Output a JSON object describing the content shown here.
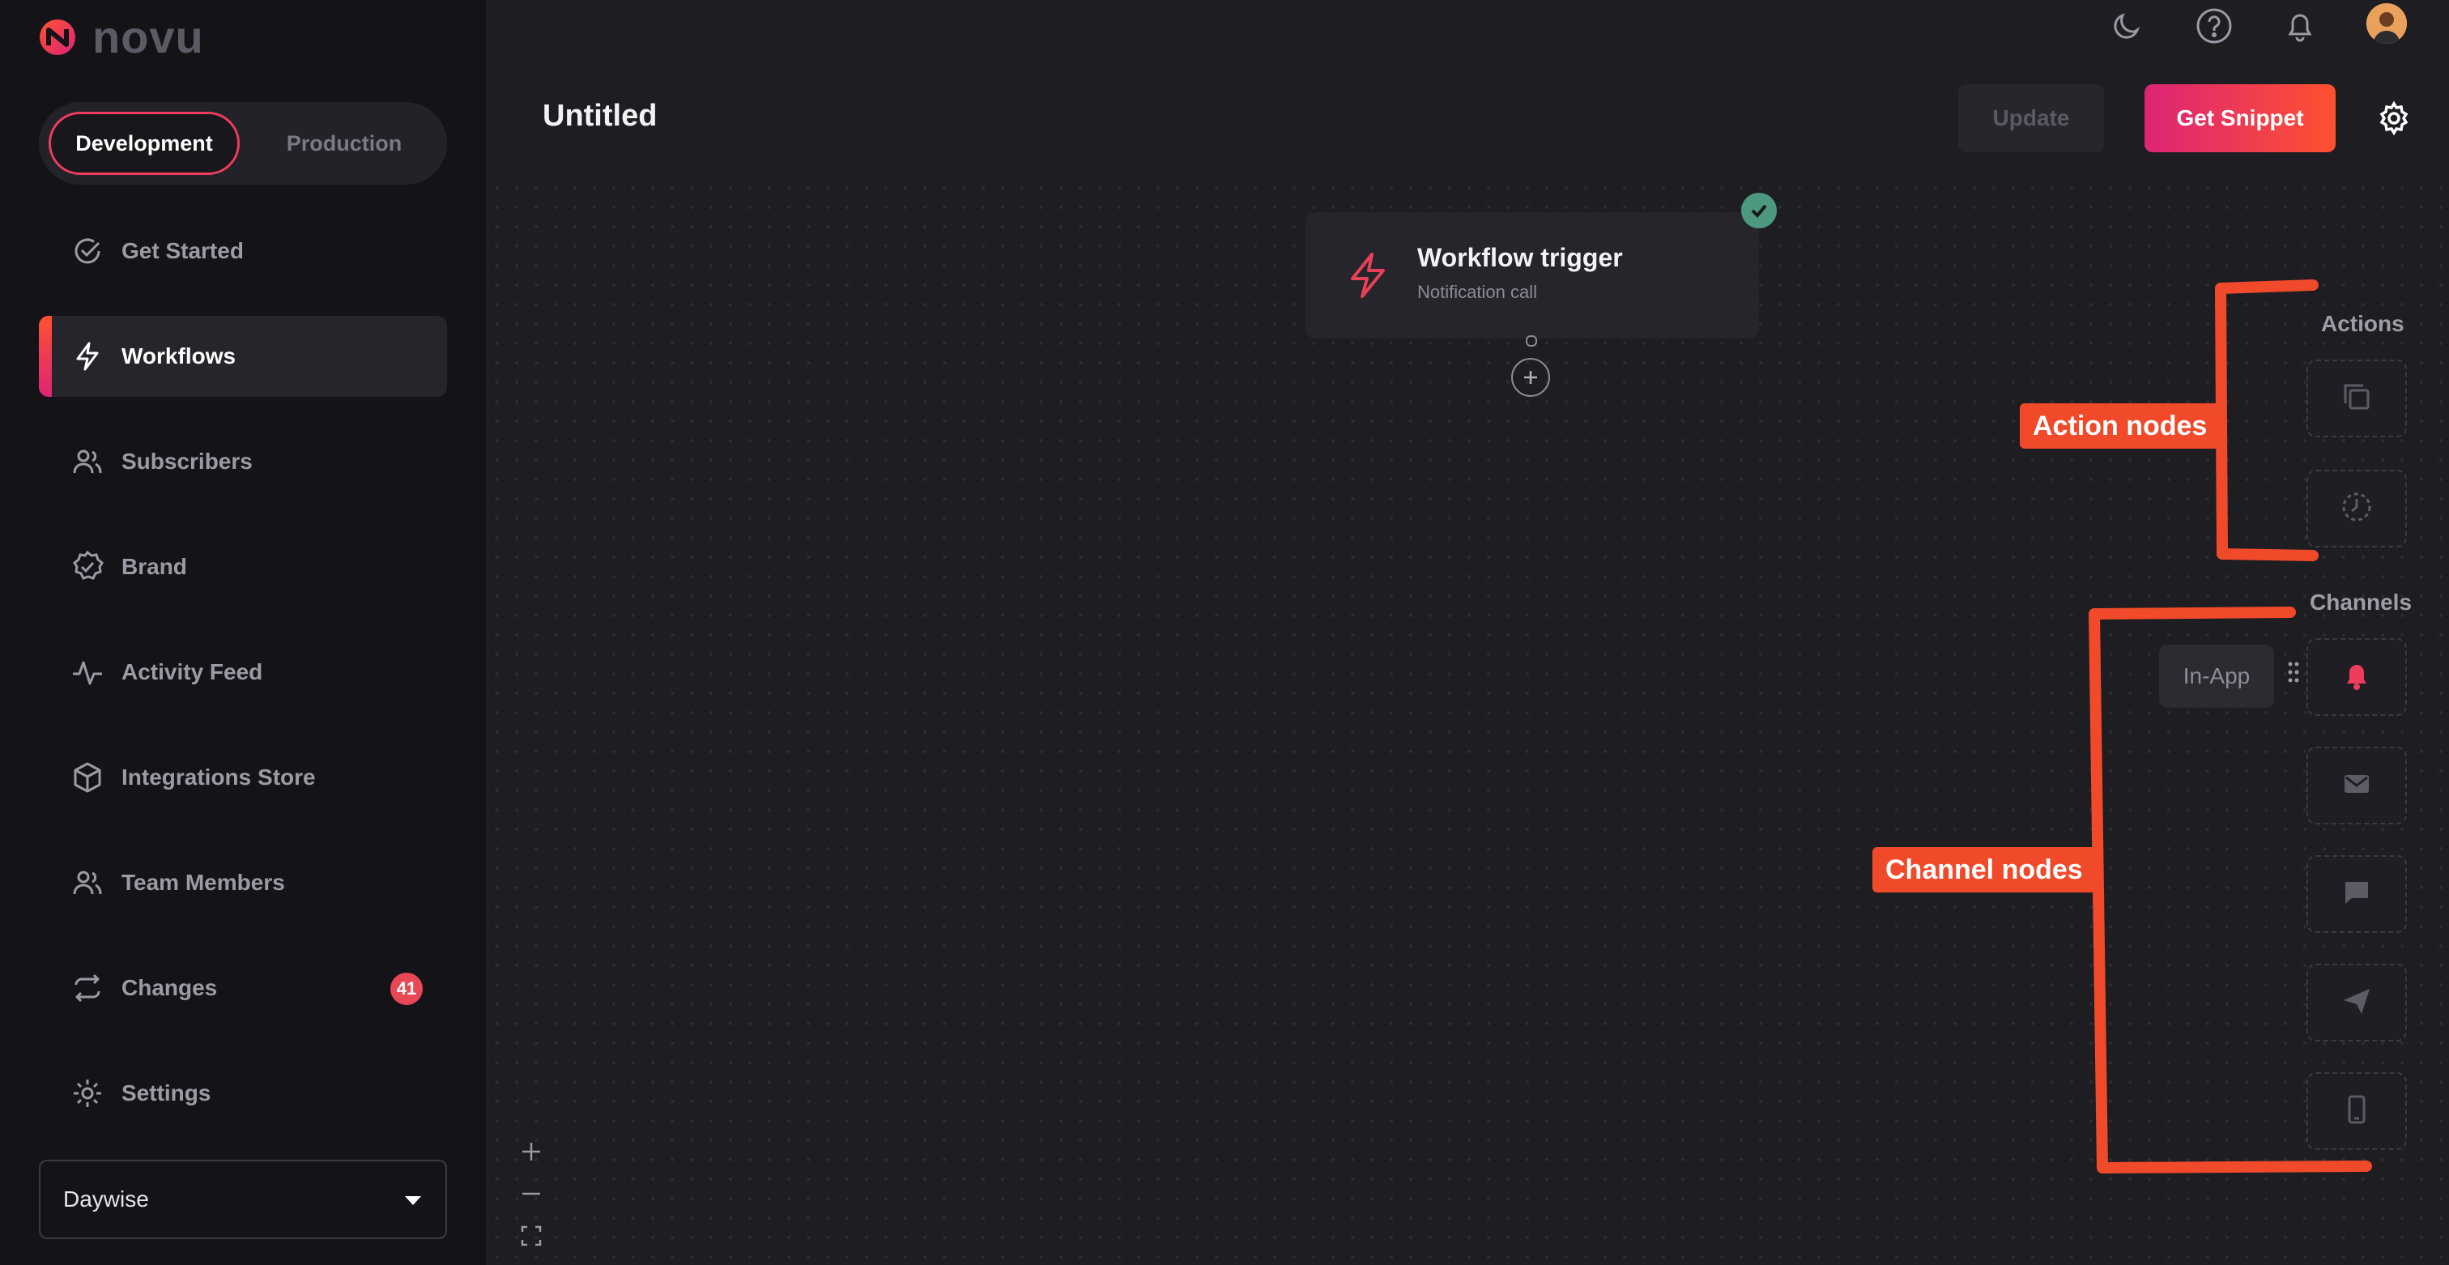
{
  "brand": {
    "name": "novu",
    "accent": "#ee3c5d",
    "gradient": [
      "#dd2476",
      "#ff512f"
    ]
  },
  "environment": {
    "options": [
      "Development",
      "Production"
    ],
    "selected": "Development"
  },
  "sidebar": {
    "items": [
      {
        "label": "Get Started",
        "icon": "check-circle-icon"
      },
      {
        "label": "Workflows",
        "icon": "bolt-icon",
        "active": true
      },
      {
        "label": "Subscribers",
        "icon": "users-icon"
      },
      {
        "label": "Brand",
        "icon": "badge-check-icon"
      },
      {
        "label": "Activity Feed",
        "icon": "activity-icon"
      },
      {
        "label": "Integrations Store",
        "icon": "box-icon"
      },
      {
        "label": "Team Members",
        "icon": "team-icon"
      },
      {
        "label": "Changes",
        "icon": "refresh-icon",
        "badge": "41"
      },
      {
        "label": "Settings",
        "icon": "gear-icon"
      }
    ],
    "organization": "Daywise"
  },
  "topbar": {
    "icons": [
      "moon-icon",
      "help-icon",
      "bell-icon",
      "avatar"
    ]
  },
  "header": {
    "title": "Untitled",
    "update_label": "Update",
    "snippet_label": "Get Snippet"
  },
  "workflow": {
    "trigger": {
      "title": "Workflow trigger",
      "subtitle": "Notification call",
      "status": "valid"
    }
  },
  "palette": {
    "actions_label": "Actions",
    "actions": [
      "digest-icon",
      "delay-icon"
    ],
    "channels_label": "Channels",
    "channels": [
      "in-app-bell-icon",
      "email-icon",
      "chat-icon",
      "push-icon",
      "sms-icon"
    ],
    "tooltip": "In-App"
  },
  "annotations": {
    "action_nodes": "Action nodes",
    "channel_nodes": "Channel nodes",
    "color": "#f04a2b"
  },
  "zoom_controls": [
    "zoom-in-icon",
    "zoom-out-icon",
    "fit-view-icon"
  ]
}
